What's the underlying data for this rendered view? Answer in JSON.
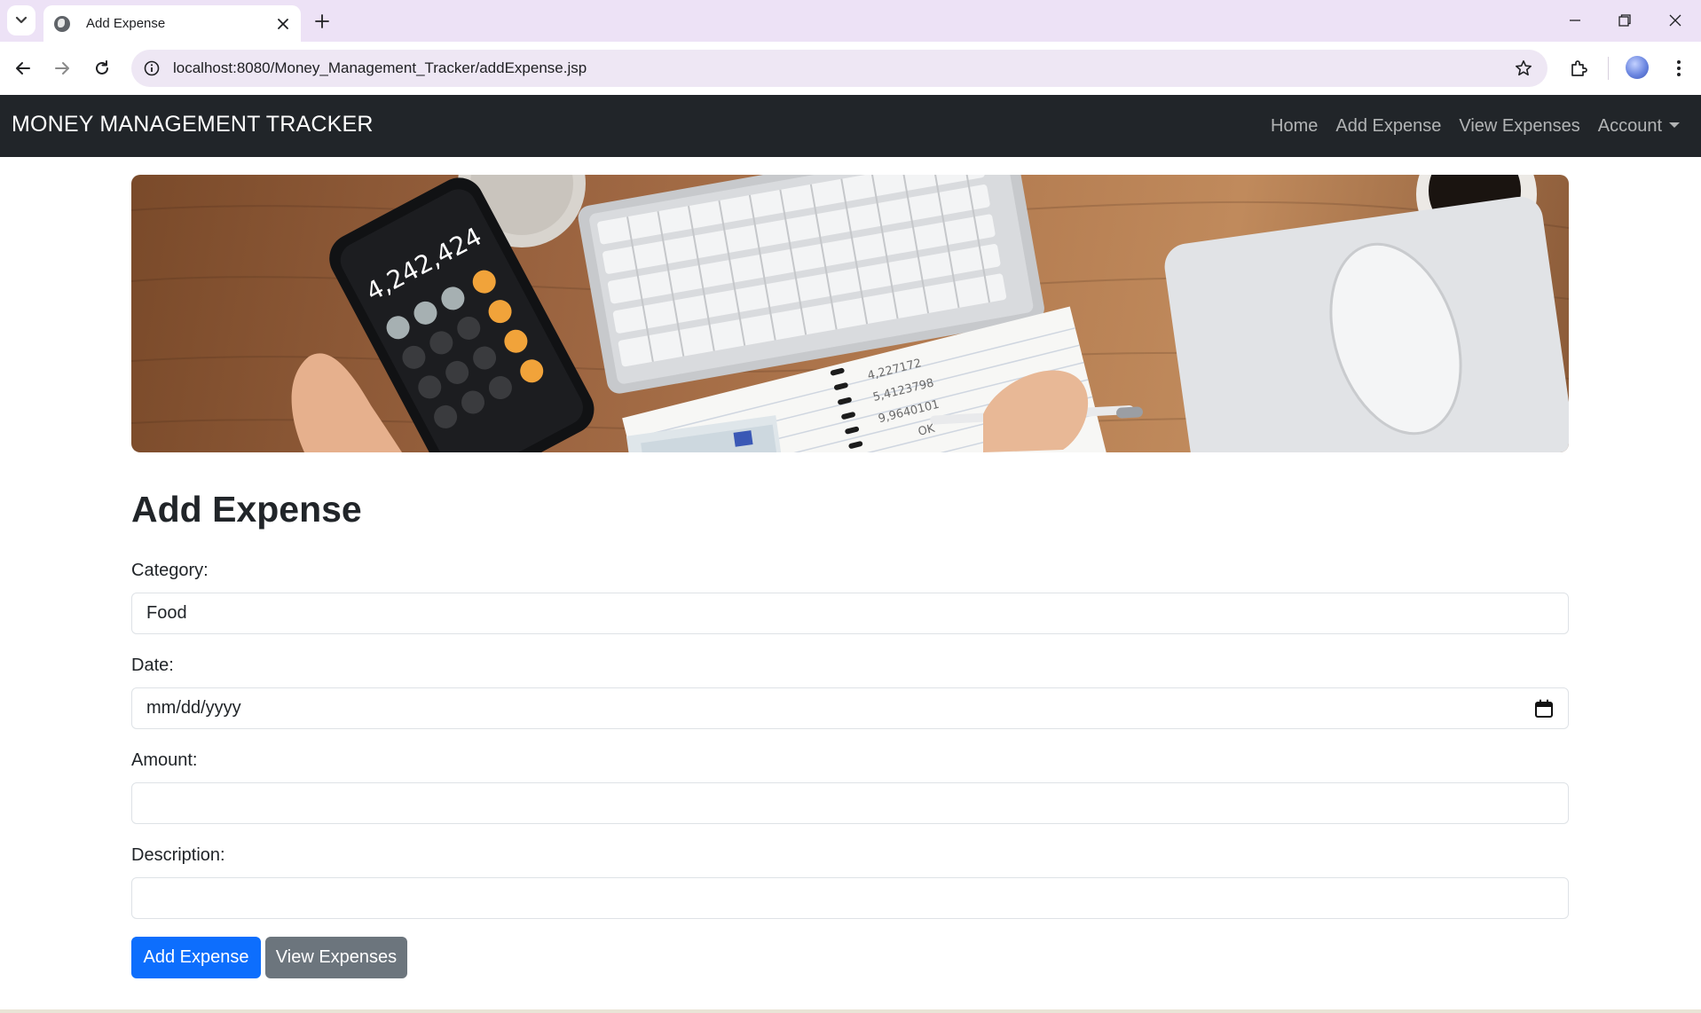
{
  "browser": {
    "tab_title": "Add Expense",
    "url": "localhost:8080/Money_Management_Tracker/addExpense.jsp"
  },
  "navbar": {
    "brand": "MONEY MANAGEMENT TRACKER",
    "links": [
      {
        "label": "Home"
      },
      {
        "label": "Add Expense"
      },
      {
        "label": "View Expenses"
      },
      {
        "label": "Account"
      }
    ]
  },
  "hero": {
    "calculator_display": "4,242,424",
    "notepad_lines": [
      "4,227172",
      "5,4123798",
      "9,9640101",
      "OK"
    ]
  },
  "form": {
    "heading": "Add Expense",
    "category": {
      "label": "Category:",
      "value": "Food"
    },
    "date": {
      "label": "Date:",
      "placeholder": "mm/dd/yyyy"
    },
    "amount": {
      "label": "Amount:",
      "value": ""
    },
    "description": {
      "label": "Description:",
      "value": ""
    },
    "submit_label": "Add Expense",
    "view_label": "View Expenses"
  },
  "colors": {
    "navbar_bg": "#212529",
    "primary": "#0d6efd",
    "secondary": "#6c757d",
    "tabbar_bg": "#ede2f6"
  },
  "icons": [
    "tab-search-icon",
    "globe-icon",
    "close-icon",
    "plus-icon",
    "minimize-icon",
    "restore-icon",
    "window-close-icon",
    "back-icon",
    "forward-icon",
    "reload-icon",
    "site-info-icon",
    "bookmark-star-icon",
    "extensions-icon",
    "profile-avatar",
    "menu-icon",
    "calendar-icon"
  ]
}
